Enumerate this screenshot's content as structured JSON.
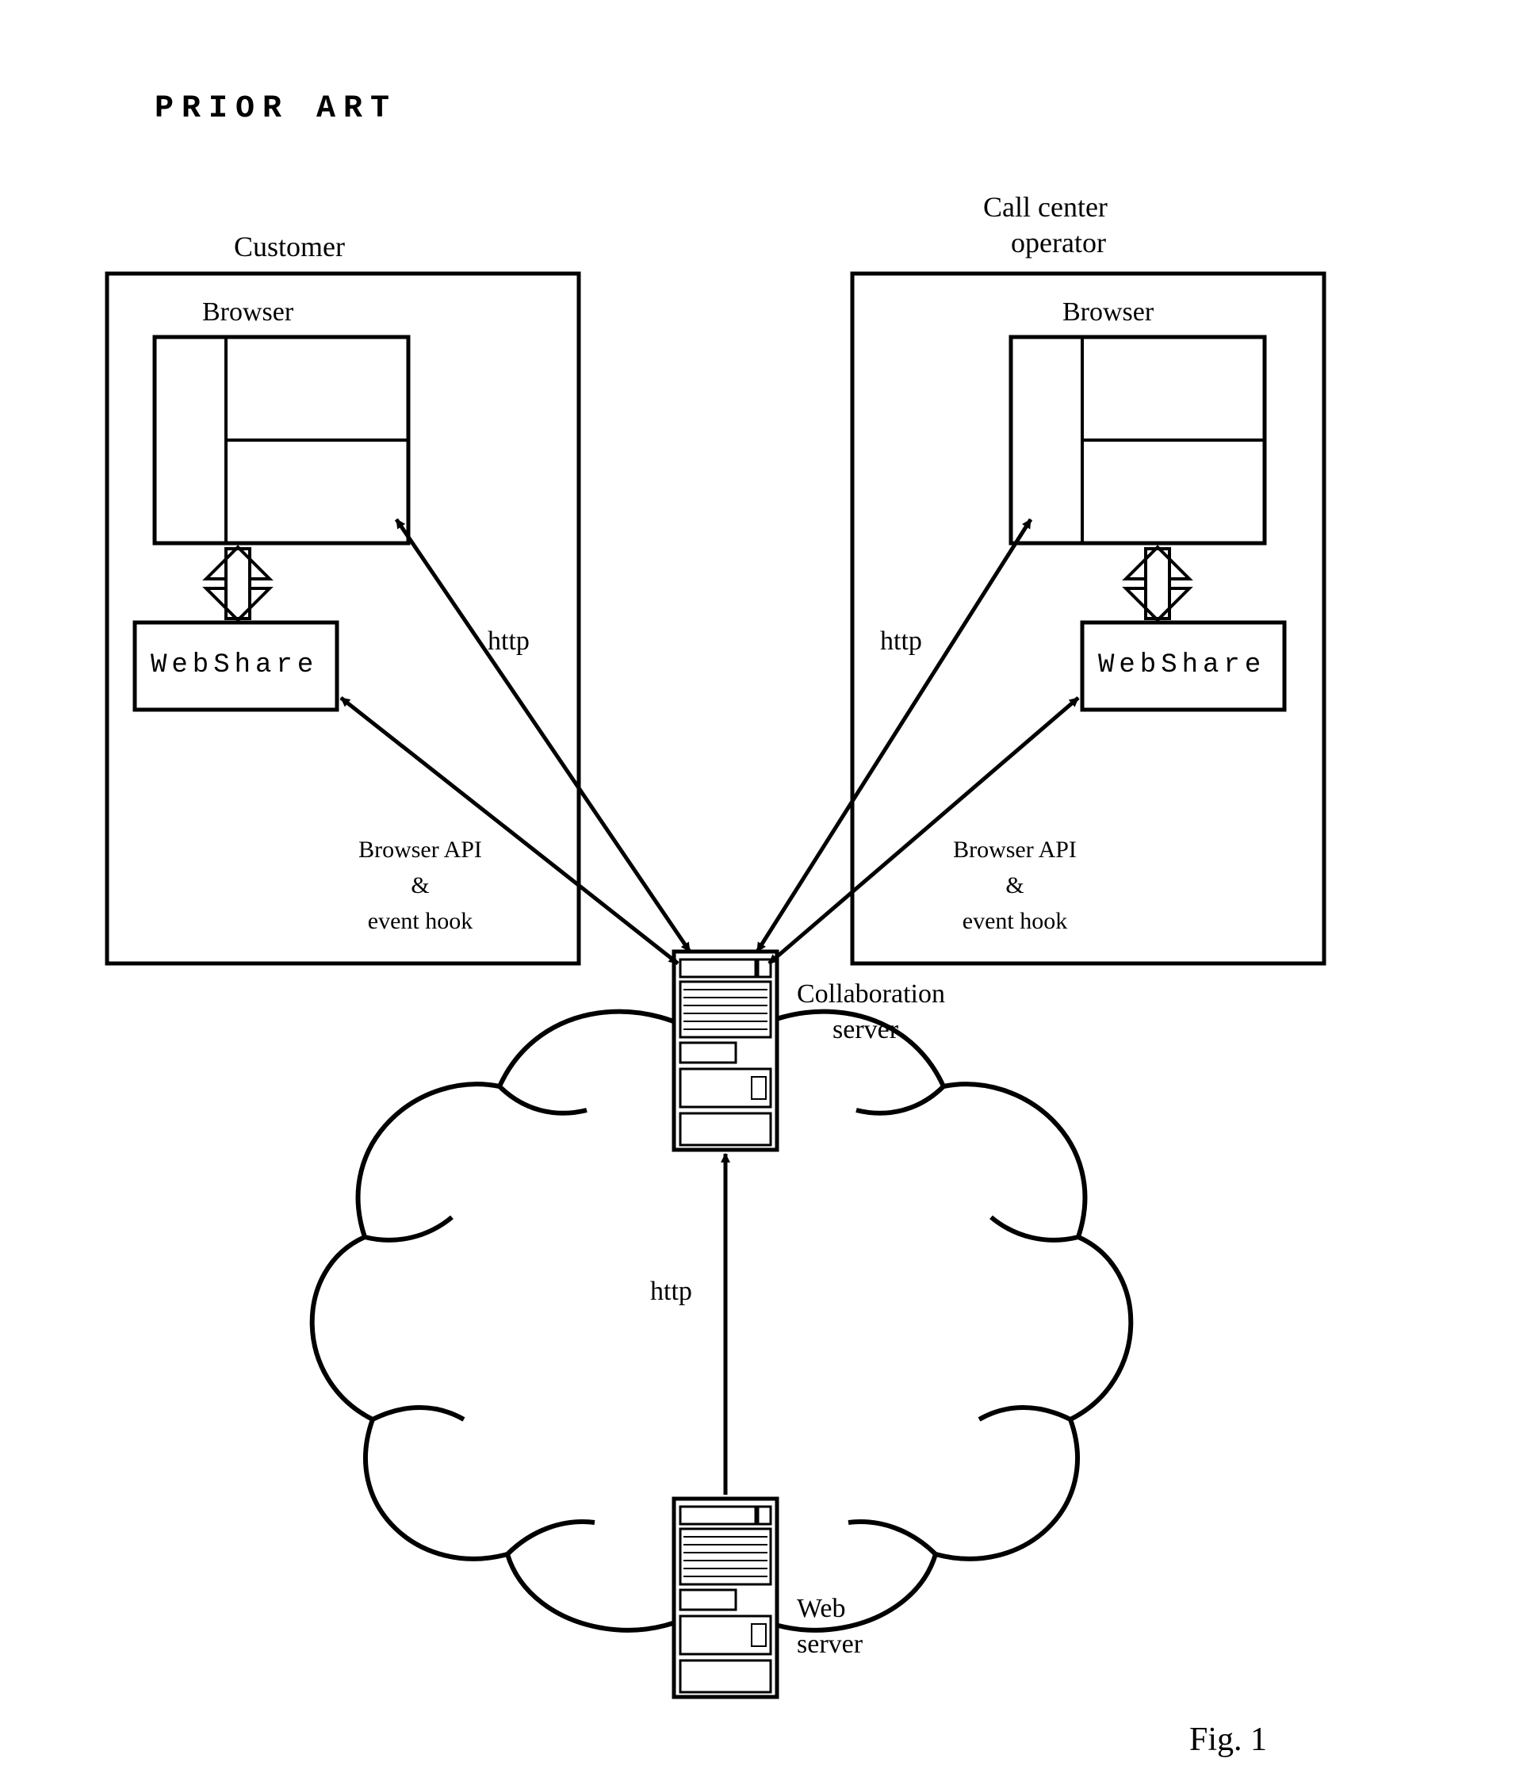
{
  "header": {
    "prior_art": "PRIOR ART"
  },
  "customer": {
    "title": "Customer",
    "browser_label": "Browser",
    "webshare_label": "WebShare",
    "api_line1": "Browser API",
    "api_line2": "&",
    "api_line3": "event hook"
  },
  "operator": {
    "title1": "Call center",
    "title2": "operator",
    "browser_label": "Browser",
    "webshare_label": "WebShare",
    "api_line1": "Browser API",
    "api_line2": "&",
    "api_line3": "event hook"
  },
  "connections": {
    "http_left": "http",
    "http_right": "http",
    "http_bottom": "http"
  },
  "servers": {
    "collab_line1": "Collaboration",
    "collab_line2": "server",
    "web_line1": "Web",
    "web_line2": "server"
  },
  "figure": {
    "label": "Fig. 1"
  }
}
